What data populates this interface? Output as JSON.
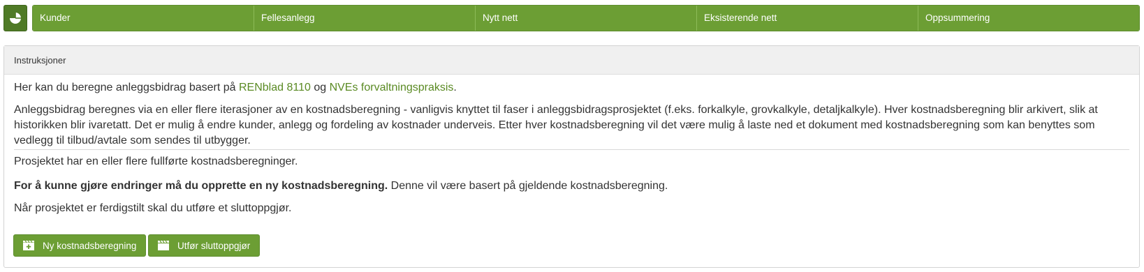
{
  "nav": {
    "tabs": [
      {
        "label": "Kunder"
      },
      {
        "label": "Fellesanlegg"
      },
      {
        "label": "Nytt nett"
      },
      {
        "label": "Eksisterende nett"
      },
      {
        "label": "Oppsummering"
      }
    ],
    "home_icon": "pie-chart-icon"
  },
  "panel": {
    "title": "Instruksjoner",
    "intro_prefix": "Her kan du beregne anleggsbidrag basert på ",
    "link1": "RENblad 8110",
    "intro_mid": " og ",
    "link2": "NVEs forvaltningspraksis",
    "intro_suffix": ".",
    "paragraph": "Anleggsbidrag beregnes via en eller flere iterasjoner av en kostnadsberegning - vanligvis knyttet til faser i anleggsbidragsprosjektet (f.eks. forkalkyle, grovkalkyle, detaljkalkyle). Hver kostnadsberegning blir arkivert, slik at historikken blir ivaretatt. Det er mulig å endre kunder, anlegg og fordeling av kostnader underveis. Etter hver kostnadsberegning vil det være mulig å laste ned et dokument med kostnadsberegning som kan benyttes som vedlegg til tilbud/avtale som sendes til utbygger.",
    "status": "Prosjektet har en eller flere fullførte kostnadsberegninger.",
    "bold_notice": "For å kunne gjøre endringer må du opprette en ny kostnadsberegning.",
    "notice_rest": " Denne vil være basert på gjeldende kostnadsberegning.",
    "final_note": "Når prosjektet er ferdigstilt skal du utføre et sluttoppgjør."
  },
  "buttons": {
    "new_calc": {
      "label": "Ny kostnadsberegning",
      "icon": "film-plus-icon"
    },
    "settlement": {
      "label": "Utfør sluttoppgjør",
      "icon": "clapperboard-icon"
    }
  },
  "colors": {
    "accent": "#6c9e34",
    "accent_dark": "#4f7a26",
    "link": "#5a8a23",
    "header_bg": "#f0f0f0"
  }
}
